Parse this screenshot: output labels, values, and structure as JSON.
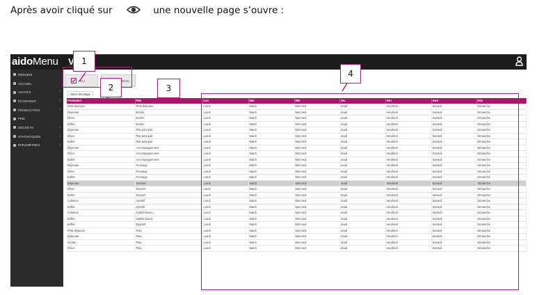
{
  "intro": {
    "before": "Après avoir cliqué sur",
    "after": "une nouvelle page s’ouvre :",
    "icon": "eye-icon"
  },
  "app": {
    "brand_bold": "aido",
    "brand_regular": "Menu",
    "brand_suffix": "V",
    "user_icon": "user-icon"
  },
  "sidebar": {
    "items": [
      {
        "label": "RÉDUIRE",
        "icon": "menu-icon",
        "chevron": false
      },
      {
        "label": "ACCUEIL",
        "icon": "home-icon",
        "chevron": false
      },
      {
        "label": "ACHATS",
        "icon": "cart-icon",
        "chevron": true
      },
      {
        "label": "ÉCONOMAT",
        "icon": "box-icon",
        "chevron": true
      },
      {
        "label": "PRODUCTION",
        "icon": "chart-icon",
        "chevron": true
      },
      {
        "label": "PMS",
        "icon": "doc-icon",
        "chevron": false
      },
      {
        "label": "DÉCHETS",
        "icon": "trash-icon",
        "chevron": true
      },
      {
        "label": "STATISTIQUES",
        "icon": "stats-icon",
        "chevron": true
      },
      {
        "label": "PARAMÈTRES",
        "icon": "gear-icon",
        "chevron": true
      }
    ]
  },
  "toolbar": {
    "maj_label": "MAJ",
    "second_label": "MENU"
  },
  "tab_label": "Sans décalage",
  "table": {
    "headers": [
      "Prestation",
      "Plat",
      "Lun",
      "Mar",
      "Mer",
      "Jeu",
      "Ven",
      "Sam",
      "Dim"
    ],
    "days": [
      "Lundi",
      "Mardi",
      "Mercredi",
      "Jeudi",
      "Vendredi",
      "Samedi",
      "Dimanche"
    ],
    "rows": [
      {
        "prestation": "Petit déjeuner",
        "plat": "Petit déjeuner"
      },
      {
        "prestation": "Déjeuner",
        "plat": "Entrée"
      },
      {
        "prestation": "Dîner",
        "plat": "Entrée"
      },
      {
        "prestation": "Buffet",
        "plat": "Entrée"
      },
      {
        "prestation": "Déjeuner",
        "plat": "Plat principal"
      },
      {
        "prestation": "Dîner",
        "plat": "Plat principal"
      },
      {
        "prestation": "Buffet",
        "plat": "Plat principal"
      },
      {
        "prestation": "Déjeuner",
        "plat": "Accompagnement"
      },
      {
        "prestation": "Dîner",
        "plat": "Accompagnement"
      },
      {
        "prestation": "Buffet",
        "plat": "Accompagnement"
      },
      {
        "prestation": "Déjeuner",
        "plat": "Fromage"
      },
      {
        "prestation": "Dîner",
        "plat": "Fromage"
      },
      {
        "prestation": "Buffet",
        "plat": "Fromage"
      },
      {
        "prestation": "Déjeuner",
        "plat": "Dessert",
        "selected": true
      },
      {
        "prestation": "Dîner",
        "plat": "Dessert"
      },
      {
        "prestation": "Buffet",
        "plat": "Dessert"
      },
      {
        "prestation": "Collation",
        "plat": "Apéritif"
      },
      {
        "prestation": "Buffet",
        "plat": "Apéritif"
      },
      {
        "prestation": "Collation",
        "plat": "Café/Infusion"
      },
      {
        "prestation": "Buffet",
        "plat": "Café/Infusion"
      },
      {
        "prestation": "Buffet",
        "plat": "Digestif"
      },
      {
        "prestation": "Petit déjeuner",
        "plat": "Pain"
      },
      {
        "prestation": "Déjeuner",
        "plat": "Pain"
      },
      {
        "prestation": "Goûter",
        "plat": "Pain"
      },
      {
        "prestation": "Dîner",
        "plat": "Pain"
      }
    ]
  },
  "callouts": [
    "1",
    "2",
    "3",
    "4"
  ],
  "colors": {
    "accent": "#a8176a",
    "annotation": "#b0187c",
    "topbar": "#1d1d1d",
    "sidebar": "#2b2b2b"
  }
}
